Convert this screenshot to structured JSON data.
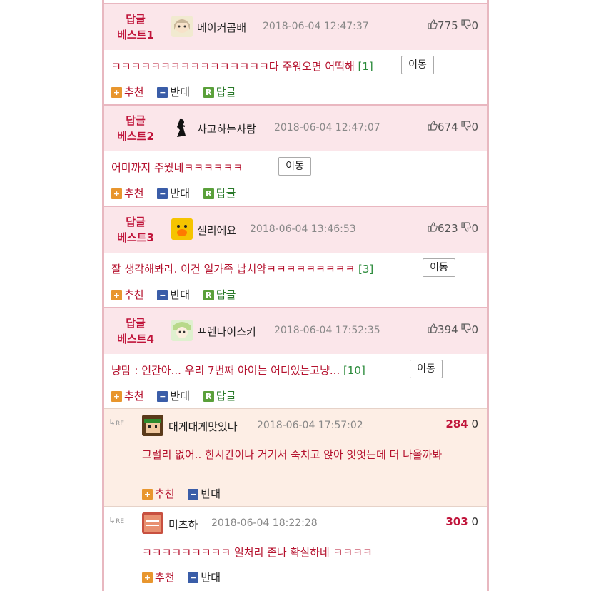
{
  "best_comments": [
    {
      "rank_line1": "답글",
      "rank_line2": "베스트1",
      "nickname": "메이커곰배",
      "date": "2018-06-04 12:47:37",
      "up": "775",
      "down": "0",
      "text": "ㅋㅋㅋㅋㅋㅋㅋㅋㅋㅋㅋㅋㅋㅋㅋㅋ다 주워오면 어떡해",
      "reply_count": "[1]",
      "move_label": "이동",
      "actions": {
        "recommend": "추천",
        "oppose": "반대",
        "reply": "답글"
      }
    },
    {
      "rank_line1": "답글",
      "rank_line2": "베스트2",
      "nickname": "사고하는사람",
      "date": "2018-06-04 12:47:07",
      "up": "674",
      "down": "0",
      "text": "어미까지 주웠네ㅋㅋㅋㅋㅋㅋ",
      "reply_count": "",
      "move_label": "이동",
      "actions": {
        "recommend": "추천",
        "oppose": "반대",
        "reply": "답글"
      }
    },
    {
      "rank_line1": "답글",
      "rank_line2": "베스트3",
      "nickname": "샐리에요",
      "date": "2018-06-04 13:46:53",
      "up": "623",
      "down": "0",
      "text": "잘 생각해봐라. 이건 일가족 납치약ㅋㅋㅋㅋㅋㅋㅋㅋㅋ",
      "reply_count": "[3]",
      "move_label": "이동",
      "actions": {
        "recommend": "추천",
        "oppose": "반대",
        "reply": "답글"
      }
    },
    {
      "rank_line1": "답글",
      "rank_line2": "베스트4",
      "nickname": "프렌다이스키",
      "date": "2018-06-04 17:52:35",
      "up": "394",
      "down": "0",
      "text": "냥맘 : 인간아... 우리 7번째 아이는 어디있는고냥...",
      "reply_count": "[10]",
      "move_label": "이동",
      "actions": {
        "recommend": "추천",
        "oppose": "반대",
        "reply": "답글"
      }
    }
  ],
  "replies": [
    {
      "re_label": "RE",
      "nickname": "대게대게맛있다",
      "date": "2018-06-04 17:57:02",
      "count": "284",
      "count_zero": "0",
      "text": "그럴리 없어.. 한시간이나 거기서 죽치고 앉아 잇엇는데 더 나올까봐",
      "actions": {
        "recommend": "추천",
        "oppose": "반대"
      }
    },
    {
      "re_label": "RE",
      "nickname": "미츠하",
      "date": "2018-06-04 18:22:28",
      "count": "303",
      "count_zero": "0",
      "text": "ㅋㅋㅋㅋㅋㅋㅋㅋㅋ 일처리 존나 확실하네 ㅋㅋㅋㅋ",
      "actions": {
        "recommend": "추천",
        "oppose": "반대"
      }
    }
  ],
  "icons": {
    "thumbs_up": "thumbs-up-icon",
    "thumbs_down": "thumbs-down-icon",
    "plus": "+",
    "minus": "−",
    "reply": "R",
    "reply_arrow": "↳"
  },
  "colors": {
    "accent_red": "#c0143a",
    "best_header_bg": "#fbe6ea",
    "reply_bg": "#fdeee5",
    "count_green": "#2a8a3a"
  }
}
